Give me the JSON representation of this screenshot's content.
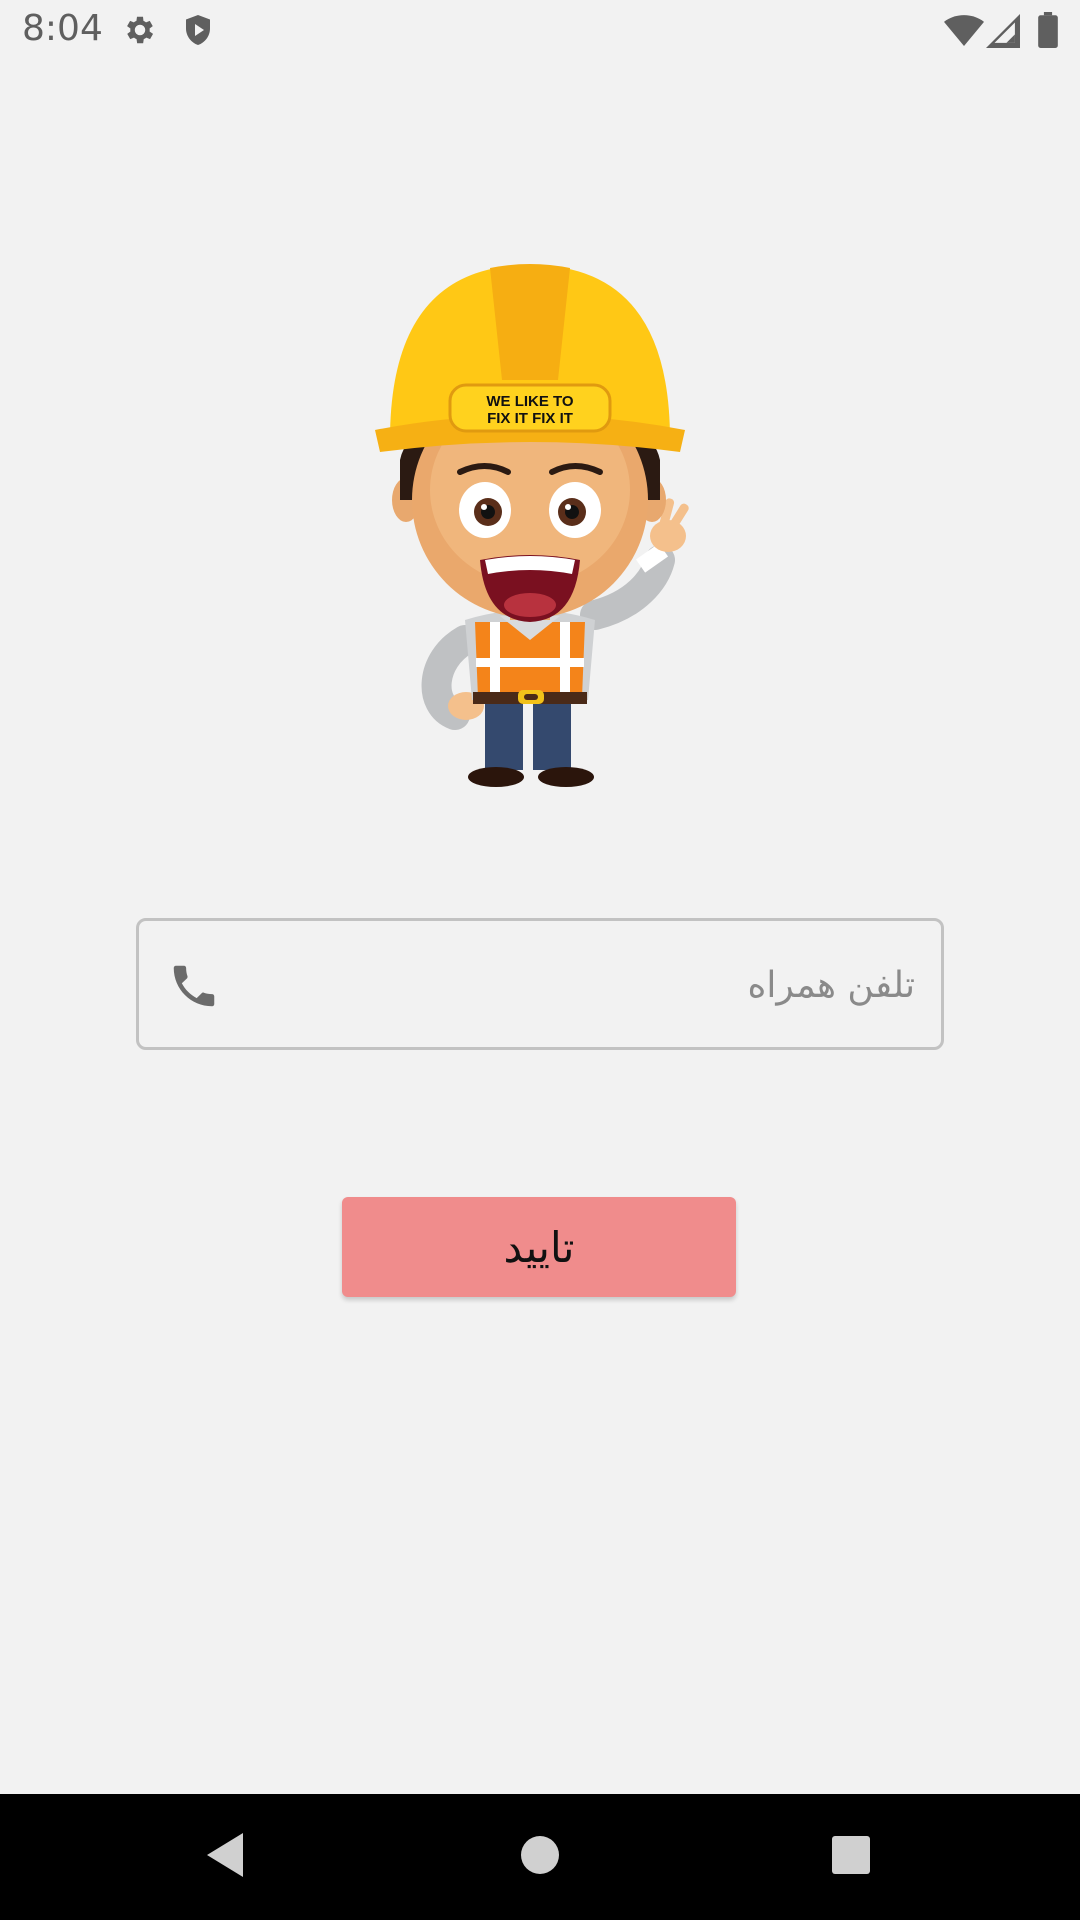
{
  "status_bar": {
    "time": "8:04",
    "icons": [
      "settings-icon",
      "shield-icon",
      "wifi-icon",
      "signal-icon",
      "battery-icon"
    ]
  },
  "illustration": {
    "name": "construction-worker-mascot",
    "helmet_text_line1": "WE LIKE TO",
    "helmet_text_line2": "FIX IT FIX IT"
  },
  "form": {
    "phone_placeholder": "تلفن همراه",
    "phone_value": "",
    "phone_icon": "phone-icon",
    "confirm_label": "تایید"
  },
  "nav_bar": {
    "buttons": [
      "back-icon",
      "home-icon",
      "recents-icon"
    ]
  },
  "colors": {
    "background": "#f2f2f2",
    "button": "#f08c8c",
    "helmet": "#ffc815",
    "vest": "#f4841a"
  }
}
